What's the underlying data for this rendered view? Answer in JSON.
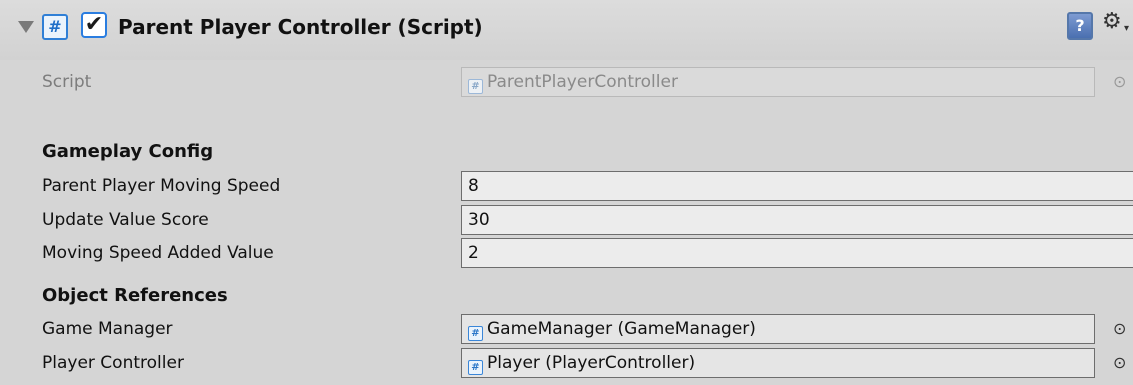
{
  "component": {
    "title": "Parent Player Controller (Script)",
    "icon": "csharp-script-icon",
    "enabled_mark": "✔",
    "help_icon": "?",
    "settings_icon": "⚙"
  },
  "script_row": {
    "label": "Script",
    "value": "ParentPlayerController"
  },
  "gameplay_config": {
    "header": "Gameplay Config",
    "fields": [
      {
        "label": "Parent Player Moving Speed",
        "value": "8"
      },
      {
        "label": "Update Value Score",
        "value": "30"
      },
      {
        "label": "Moving Speed Added Value",
        "value": "2"
      }
    ]
  },
  "object_references": {
    "header": "Object References",
    "fields": [
      {
        "label": "Game Manager",
        "value": "GameManager (GameManager)"
      },
      {
        "label": "Player Controller",
        "value": "Player (PlayerController)"
      }
    ]
  },
  "picker_glyph": "⊙",
  "colors": {
    "background": "#d5d5d5",
    "accent": "#2a7de0"
  }
}
